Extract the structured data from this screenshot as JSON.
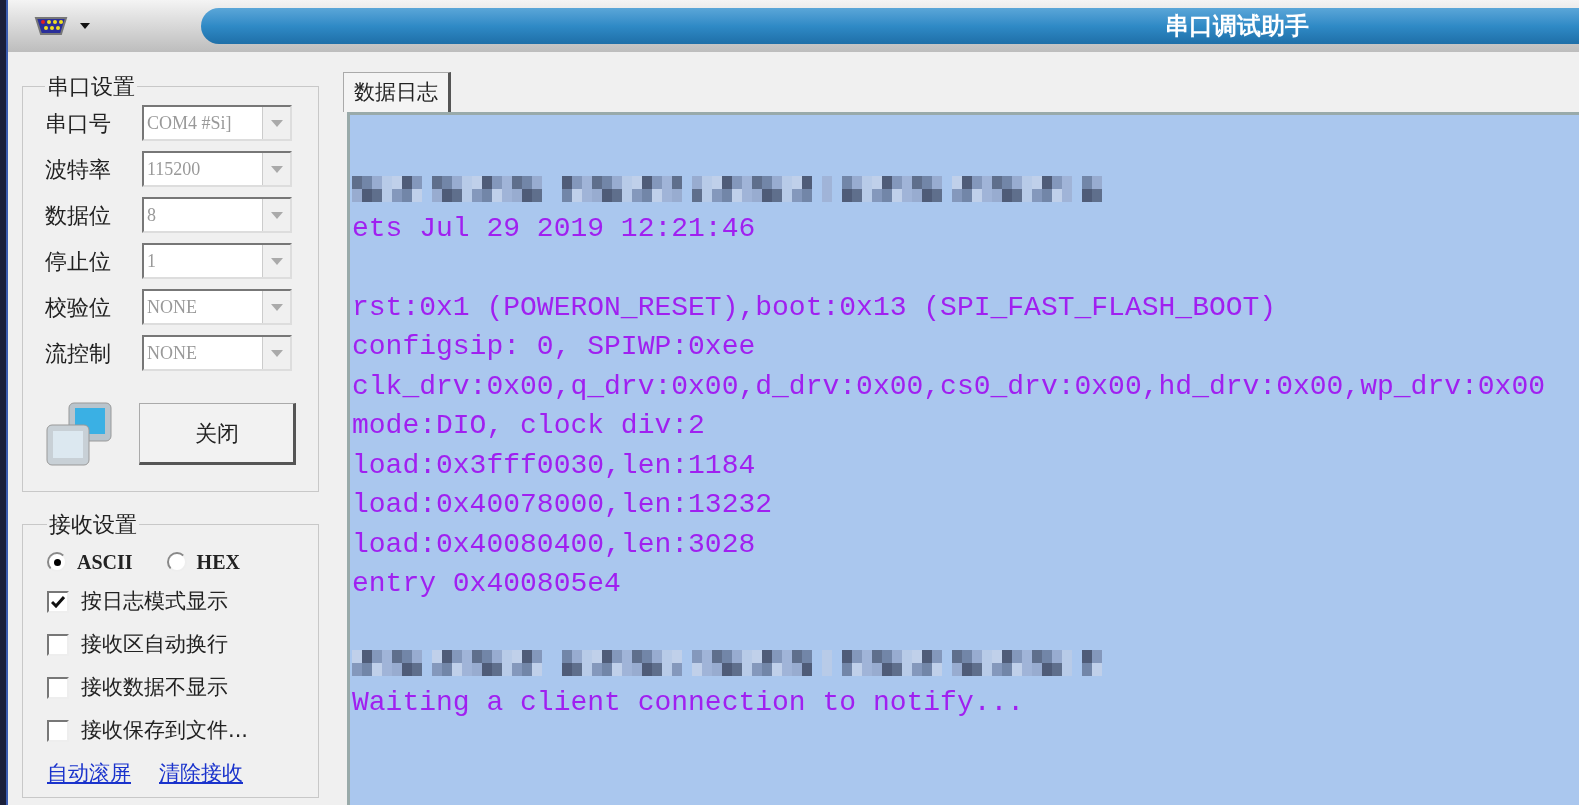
{
  "window": {
    "title": "串口调试助手"
  },
  "serial_settings": {
    "title": "串口设置",
    "fields": [
      {
        "label": "串口号",
        "value": "COM4 #Si]"
      },
      {
        "label": "波特率",
        "value": "115200"
      },
      {
        "label": "数据位",
        "value": "8"
      },
      {
        "label": "停止位",
        "value": "1"
      },
      {
        "label": "校验位",
        "value": "NONE"
      },
      {
        "label": "流控制",
        "value": "NONE"
      }
    ],
    "close_button": "关闭"
  },
  "receive_settings": {
    "title": "接收设置",
    "radios": [
      {
        "label": "ASCII",
        "selected": true
      },
      {
        "label": "HEX",
        "selected": false
      }
    ],
    "checkboxes": [
      {
        "label": "按日志模式显示",
        "checked": true
      },
      {
        "label": "接收区自动换行",
        "checked": false
      },
      {
        "label": "接收数据不显示",
        "checked": false
      },
      {
        "label": "接收保存到文件...",
        "checked": false
      }
    ],
    "links": [
      "自动滚屏",
      "清除接收"
    ]
  },
  "tabs": [
    {
      "label": "数据日志",
      "selected": true
    }
  ],
  "log": [
    {
      "kind": "blank"
    },
    {
      "kind": "redacted"
    },
    {
      "kind": "text",
      "text": "ets Jul 29 2019 12:21:46"
    },
    {
      "kind": "blank"
    },
    {
      "kind": "text",
      "text": "rst:0x1 (POWERON_RESET),boot:0x13 (SPI_FAST_FLASH_BOOT)"
    },
    {
      "kind": "text",
      "text": "configsip: 0, SPIWP:0xee"
    },
    {
      "kind": "text",
      "text": "clk_drv:0x00,q_drv:0x00,d_drv:0x00,cs0_drv:0x00,hd_drv:0x00,wp_drv:0x00"
    },
    {
      "kind": "text",
      "text": "mode:DIO, clock div:2"
    },
    {
      "kind": "text",
      "text": "load:0x3fff0030,len:1184"
    },
    {
      "kind": "text",
      "text": "load:0x40078000,len:13232"
    },
    {
      "kind": "text",
      "text": "load:0x40080400,len:3028"
    },
    {
      "kind": "text",
      "text": "entry 0x400805e4"
    },
    {
      "kind": "blank"
    },
    {
      "kind": "redacted"
    },
    {
      "kind": "text",
      "text": "Waiting a client connection to notify..."
    }
  ]
}
